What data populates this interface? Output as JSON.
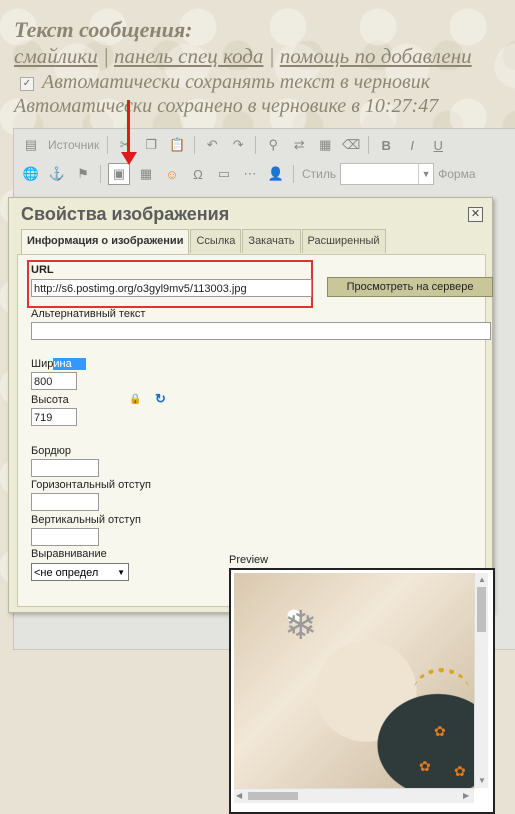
{
  "page": {
    "message_title": "Текст сообщения:",
    "links": [
      "смайлики",
      "панель спец кода",
      "помощь по добавлени"
    ],
    "link_separator": "|",
    "autosave_label": "Автоматически сохранять текст в черновик",
    "autosave_status": "Автоматически сохранено в черновике в 10:27:47"
  },
  "toolbar": {
    "source_label": "Источник",
    "bold": "B",
    "italic": "I",
    "underline": "U",
    "style_label": "Стиль",
    "format_label": "Форма"
  },
  "dialog": {
    "title": "Свойства изображения",
    "close": "✕",
    "tabs": [
      "Информация о изображении",
      "Ссылка",
      "Закачать",
      "Расширенный"
    ],
    "url_label": "URL",
    "url_value": "http://s6.postimg.org/o3gyl9mv5/113003.jpg",
    "browse_button": "Просмотреть на сервере",
    "alt_label": "Альтернативный текст",
    "alt_value": "",
    "width_label_plain": "Шир",
    "width_label_selected": "ина",
    "width_value": "800",
    "height_label": "Высота",
    "height_value": "719",
    "border_label": "Бордюр",
    "border_value": "",
    "hspace_label": "Горизонтальный отступ",
    "hspace_value": "",
    "vspace_label": "Вертикальный отступ",
    "vspace_value": "",
    "align_label": "Выравнивание",
    "align_value": "<не определ",
    "preview_label": "Preview"
  },
  "icons": [
    "source-icon",
    "cut-icon",
    "copy-icon",
    "paste-icon",
    "undo-icon",
    "redo-icon",
    "find-icon",
    "replace-icon",
    "select-all-icon",
    "remove-format-icon",
    "image-icon",
    "table-icon",
    "smiley-icon",
    "special-char-icon",
    "horizontal-rule-icon",
    "page-break-icon",
    "user-icon",
    "lock-ratio-icon",
    "reset-size-icon"
  ],
  "colors": {
    "accent_red": "#e0191d",
    "dialog_bg": "#ecebd6",
    "button_bg": "#c9c79a"
  }
}
